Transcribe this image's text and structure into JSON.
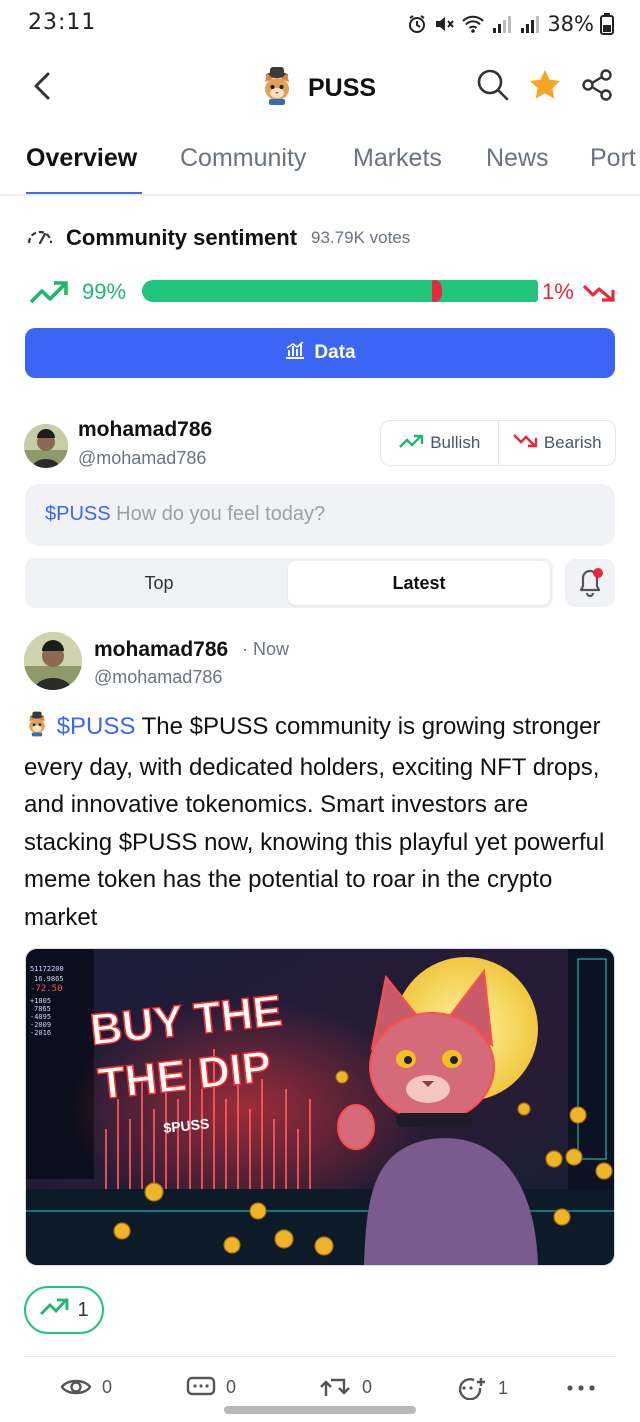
{
  "status": {
    "time": "23:11",
    "battery": "38%"
  },
  "header": {
    "title": "PUSS",
    "back_icon": "chevron-left-icon",
    "search_icon": "search-icon",
    "favorite_icon": "star-icon",
    "share_icon": "share-icon"
  },
  "tabs": [
    {
      "label": "Overview",
      "active": true
    },
    {
      "label": "Community"
    },
    {
      "label": "Markets"
    },
    {
      "label": "News"
    },
    {
      "label": "Port"
    }
  ],
  "sentiment": {
    "title": "Community sentiment",
    "votes": "93.79K votes",
    "bullish_pct": "99%",
    "bearish_pct": "1%",
    "bullish_fraction": 0.99
  },
  "data_button": {
    "label": "Data"
  },
  "current_user": {
    "name": "mohamad786",
    "handle": "@mohamad786"
  },
  "vote": {
    "bullish_label": "Bullish",
    "bearish_label": "Bearish"
  },
  "compose": {
    "ticker": "$PUSS",
    "placeholder": "How do you feel today?"
  },
  "sort": {
    "top_label": "Top",
    "latest_label": "Latest",
    "selected": "Latest"
  },
  "post": {
    "user": "mohamad786",
    "time": "· Now",
    "handle": "@mohamad786",
    "ticker": "$PUSS",
    "text": " The $PUSS community is growing stronger every day, with dedicated holders, exciting NFT drops, and innovative tokenomics. Smart investors are stacking $PUSS now, knowing this playful yet powerful meme token has the potential to roar in the crypto market",
    "image": {
      "headline_line1": "BUY THE",
      "headline_line2": "THE DIP",
      "tag": "$PUSS",
      "ticker_numbers": [
        "51172200",
        "16.9865",
        "-72.50",
        "+1805",
        "7865",
        "-4095",
        "-2009",
        "-2016"
      ]
    },
    "likes": "1",
    "views": "0",
    "comments": "0",
    "reposts": "0",
    "reactions": "1"
  },
  "colors": {
    "accent": "#3b66f5",
    "bullish": "#1ec57b",
    "bearish": "#e8283c"
  }
}
